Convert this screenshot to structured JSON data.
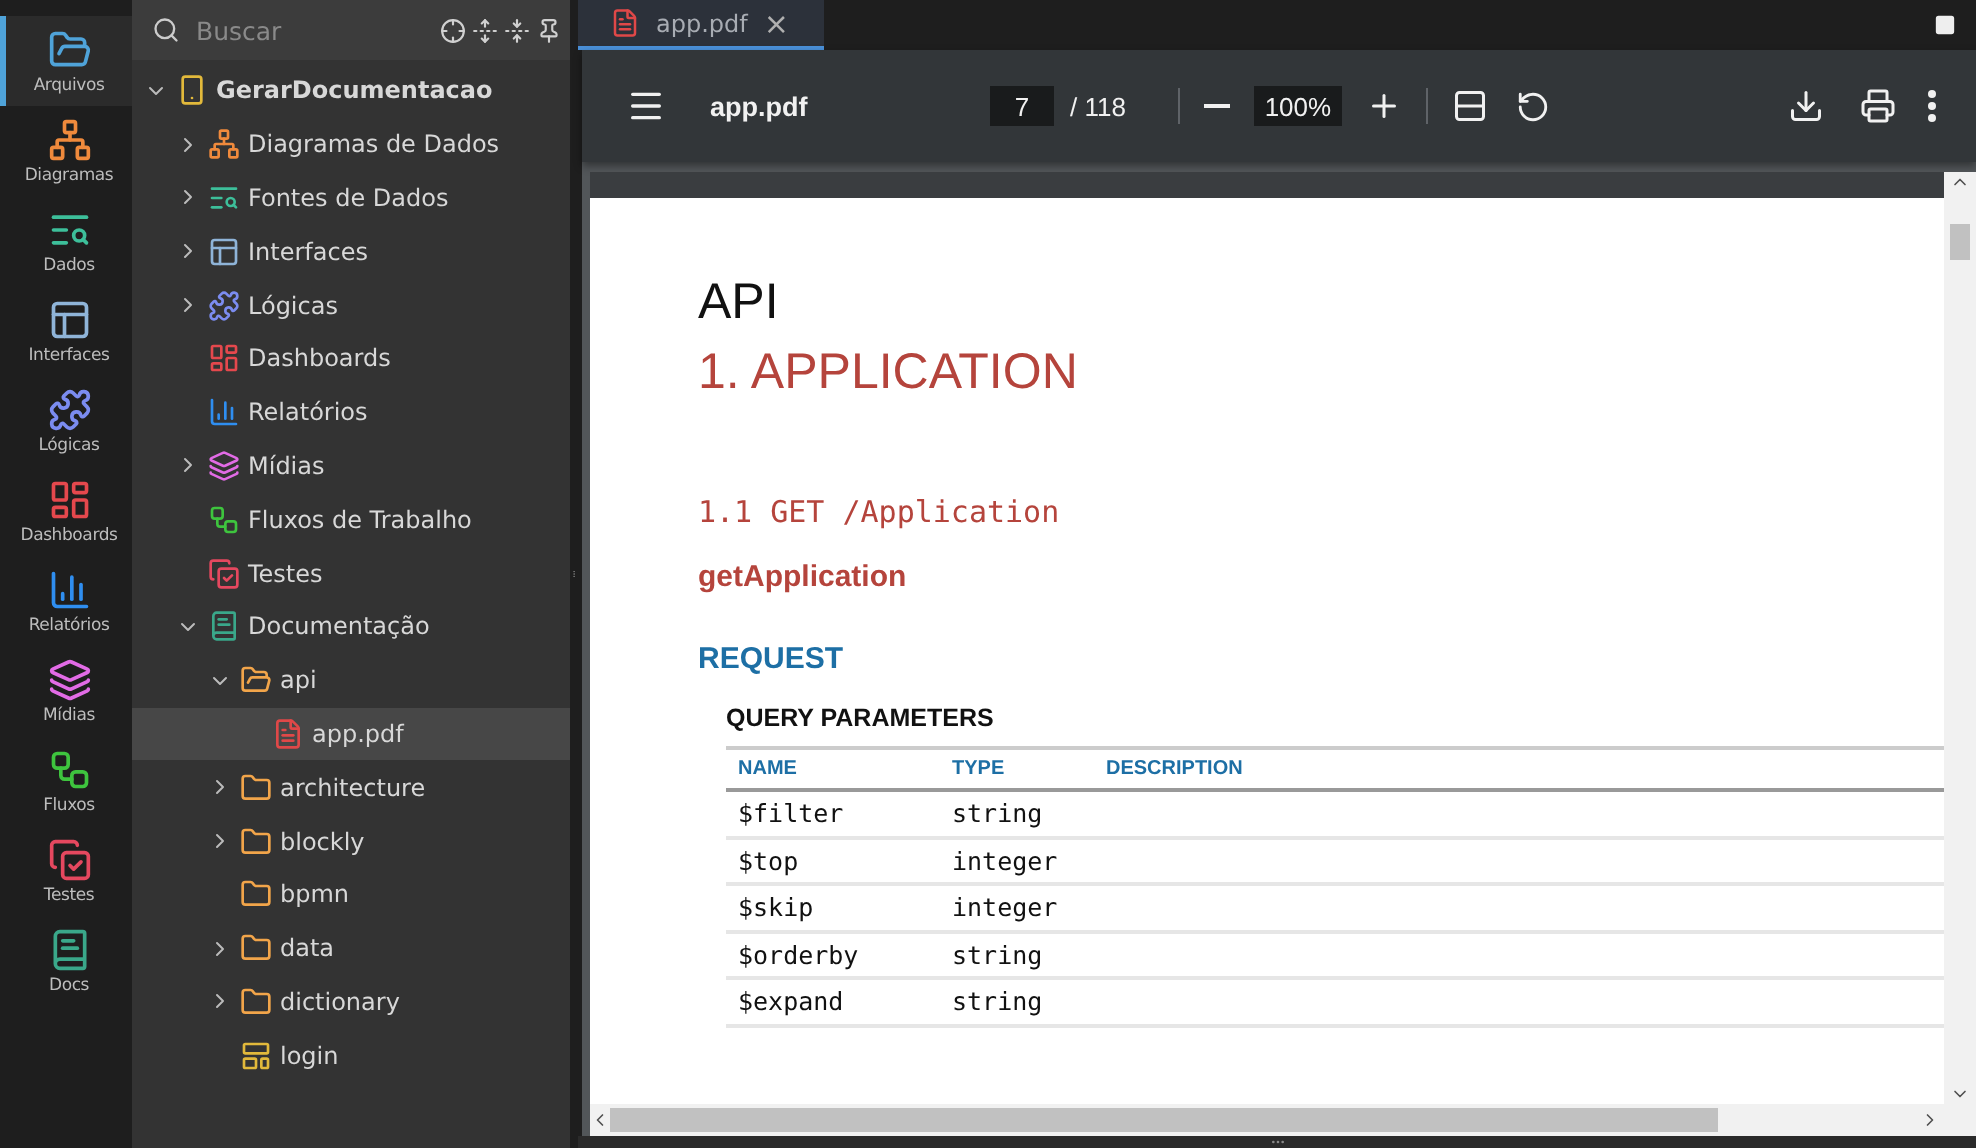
{
  "activity_bar": [
    {
      "label": "Arquivos",
      "kind": "files",
      "selected": true
    },
    {
      "label": "Diagramas",
      "kind": "diagrams",
      "selected": false
    },
    {
      "label": "Dados",
      "kind": "data",
      "selected": false
    },
    {
      "label": "Interfaces",
      "kind": "interfaces",
      "selected": false
    },
    {
      "label": "Lógicas",
      "kind": "logic",
      "selected": false
    },
    {
      "label": "Dashboards",
      "kind": "dashboards",
      "selected": false
    },
    {
      "label": "Relatórios",
      "kind": "reports",
      "selected": false
    },
    {
      "label": "Mídias",
      "kind": "media",
      "selected": false
    },
    {
      "label": "Fluxos",
      "kind": "flows",
      "selected": false
    },
    {
      "label": "Testes",
      "kind": "tests",
      "selected": false
    },
    {
      "label": "Docs",
      "kind": "docs",
      "selected": false
    }
  ],
  "sidebar": {
    "search": {
      "placeholder": "Buscar"
    },
    "tree": [
      {
        "label": "GerarDocumentacao",
        "kind": "project",
        "expanded": true,
        "selected": false,
        "children": [
          {
            "label": "Diagramas de Dados",
            "kind": "diagrams",
            "expanded": false,
            "selected": false
          },
          {
            "label": "Fontes de Dados",
            "kind": "data",
            "expanded": false,
            "selected": false
          },
          {
            "label": "Interfaces",
            "kind": "interfaces",
            "expanded": false,
            "selected": false
          },
          {
            "label": "Lógicas",
            "kind": "logic",
            "expanded": false,
            "selected": false
          },
          {
            "label": "Dashboards",
            "kind": "dashboards",
            "selected": false
          },
          {
            "label": "Relatórios",
            "kind": "reports",
            "selected": false
          },
          {
            "label": "Mídias",
            "kind": "media",
            "expanded": false,
            "selected": false
          },
          {
            "label": "Fluxos de Trabalho",
            "kind": "flows",
            "selected": false
          },
          {
            "label": "Testes",
            "kind": "tests",
            "selected": false
          },
          {
            "label": "Documentação",
            "kind": "docs",
            "expanded": true,
            "selected": false,
            "children": [
              {
                "label": "api",
                "kind": "folder",
                "expanded": true,
                "selected": false,
                "children": [
                  {
                    "label": "app.pdf",
                    "kind": "pdf",
                    "selected": true
                  }
                ]
              },
              {
                "label": "architecture",
                "kind": "folder",
                "expanded": false,
                "selected": false
              },
              {
                "label": "blockly",
                "kind": "folder",
                "expanded": false,
                "selected": false
              },
              {
                "label": "bpmn",
                "kind": "folder",
                "selected": false
              },
              {
                "label": "data",
                "kind": "folder",
                "expanded": false,
                "selected": false
              },
              {
                "label": "dictionary",
                "kind": "folder",
                "expanded": false,
                "selected": false
              },
              {
                "label": "login",
                "kind": "screen",
                "selected": false
              }
            ]
          }
        ]
      }
    ]
  },
  "tabs": [
    {
      "label": "app.pdf",
      "close": "×",
      "selected": true
    }
  ],
  "pdf_viewer": {
    "title": "app.pdf",
    "page": "7",
    "page_total": "/ 118",
    "zoom": "100%",
    "document": {
      "heading": "API",
      "section": "1. APPLICATION",
      "endpoint": "1.1 GET /Application",
      "operation": "getApplication",
      "request": "REQUEST",
      "params_title": "QUERY PARAMETERS",
      "columns": [
        "NAME",
        "TYPE",
        "DESCRIPTION"
      ],
      "rows": [
        [
          "$filter",
          "string"
        ],
        [
          "$top",
          "integer"
        ],
        [
          "$skip",
          "integer"
        ],
        [
          "$orderby",
          "string"
        ],
        [
          "$expand",
          "string"
        ]
      ]
    }
  }
}
